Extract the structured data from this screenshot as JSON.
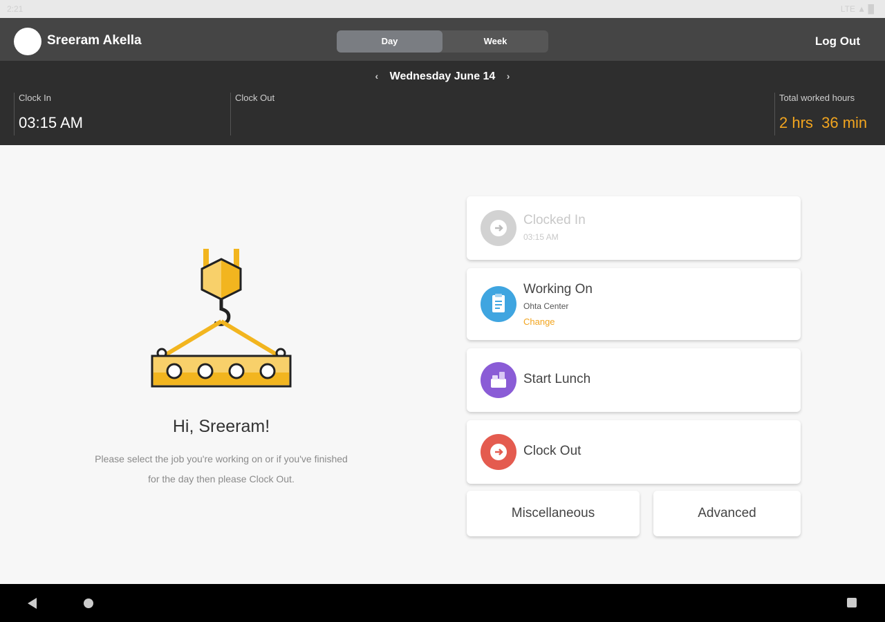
{
  "status_bar": {
    "time": "2:21",
    "signal": "LTE ▲ █"
  },
  "header": {
    "user_name": "Sreeram Akella",
    "tabs": [
      "Day",
      "Week"
    ],
    "active_tab": "Day",
    "logout_label": "Log Out"
  },
  "summary": {
    "date": "Wednesday June 14",
    "clock_in_label": "Clock In",
    "clock_in_value": "03:15 AM",
    "clock_out_label": "Clock Out",
    "clock_out_value": "",
    "total_label": "Total worked hours",
    "total_value": "2 hrs  36 min"
  },
  "greeting": {
    "title": "Hi, Sreeram!",
    "line1": "Please select the job you're working on or if you've finished",
    "line2": "for the day then please Clock Out."
  },
  "cards": {
    "clocked_in": {
      "title": "Clocked In",
      "sub": "03:15 AM",
      "icon": "arrow-right-icon",
      "color": "#cfcfcf"
    },
    "working_on": {
      "title": "Working On",
      "sub": "Ohta Center",
      "link": "Change",
      "icon": "clipboard-icon",
      "color": "#3fa5e0"
    },
    "start_lunch": {
      "title": "Start Lunch",
      "icon": "lunch-icon",
      "color": "#8a5cd6"
    },
    "clock_out": {
      "title": "Clock Out",
      "icon": "clock-out-icon",
      "color": "#e45b4f"
    }
  },
  "buttons": {
    "misc": "Miscellaneous",
    "advanced": "Advanced"
  },
  "colors": {
    "accent": "#f2a51f",
    "topbar": "#454545",
    "summary_bg": "#2e2e2e"
  }
}
